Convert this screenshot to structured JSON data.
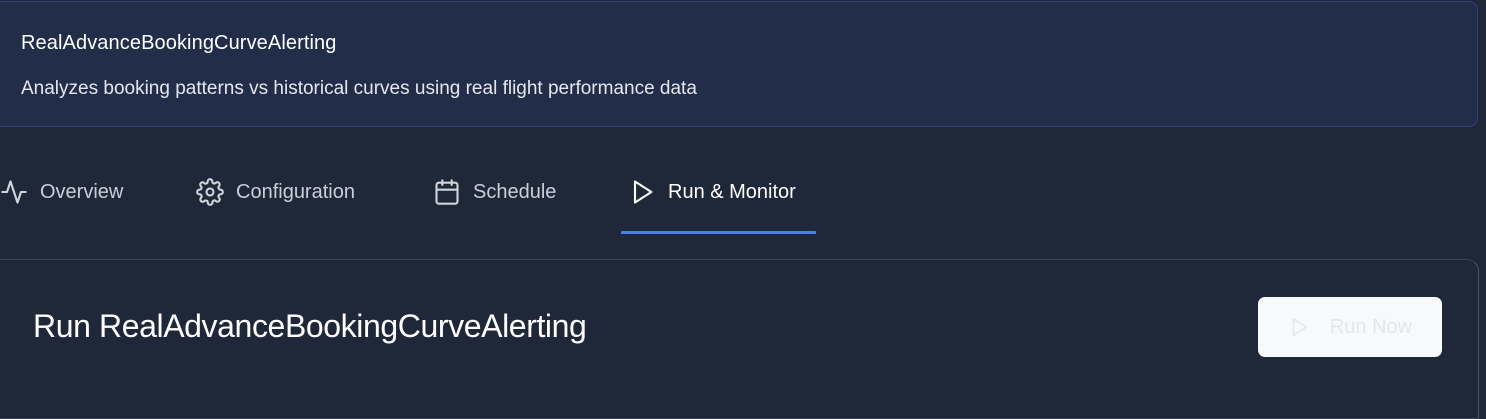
{
  "header": {
    "title": "RealAdvanceBookingCurveAlerting",
    "description": "Analyzes booking patterns vs historical curves using real flight performance data"
  },
  "tabs": [
    {
      "label": "Overview",
      "icon": "activity-icon"
    },
    {
      "label": "Configuration",
      "icon": "gear-icon"
    },
    {
      "label": "Schedule",
      "icon": "calendar-icon"
    },
    {
      "label": "Run & Monitor",
      "icon": "play-icon",
      "active": true
    }
  ],
  "run_panel": {
    "title": "Run RealAdvanceBookingCurveAlerting",
    "run_button_label": "Run Now",
    "run_button_icon": "play-icon"
  },
  "colors": {
    "background": "#1f2839",
    "header_bg": "#222d4a",
    "header_border": "#2f3e80",
    "active_tab_underline": "#4f7fe4"
  }
}
